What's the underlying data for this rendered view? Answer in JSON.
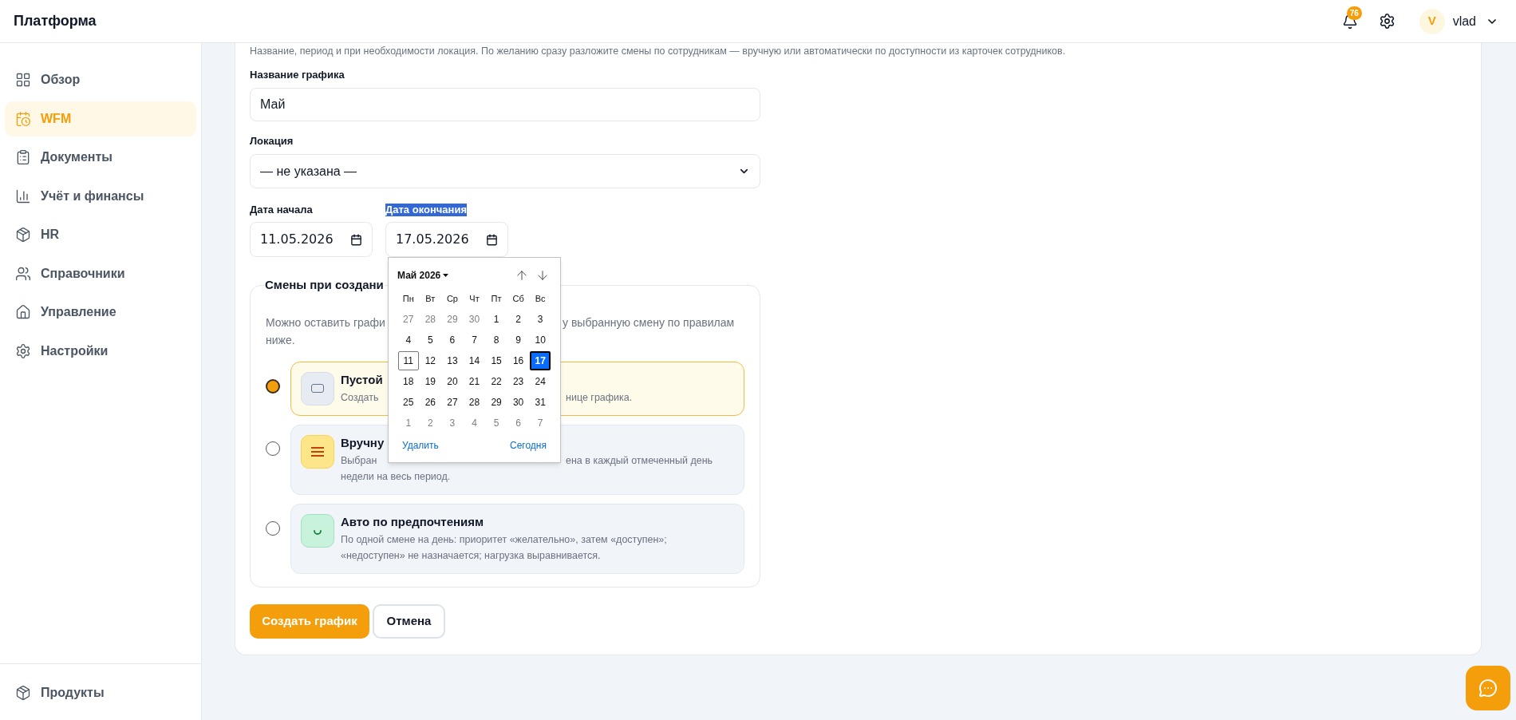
{
  "app": {
    "title": "Платформа"
  },
  "header": {
    "notifications": "76",
    "user": {
      "initial": "V",
      "name": "vlad"
    }
  },
  "sidebar": {
    "items": [
      {
        "label": "Обзор",
        "selected": false
      },
      {
        "label": "WFM",
        "selected": true
      },
      {
        "label": "Документы",
        "selected": false
      },
      {
        "label": "Учёт и финансы",
        "selected": false
      },
      {
        "label": "HR",
        "selected": false
      },
      {
        "label": "Справочники",
        "selected": false
      },
      {
        "label": "Управление",
        "selected": false
      },
      {
        "label": "Настройки",
        "selected": false
      }
    ],
    "footer": [
      {
        "label": "Продукты",
        "selected": false
      }
    ]
  },
  "form": {
    "intro": "Название, период и при необходимости локация. По желанию сразу разложите смены по сотрудникам — вручную или автоматически по доступности из карточек сотрудников.",
    "name_field": {
      "label": "Название графика",
      "value": "Май"
    },
    "location": {
      "label": "Локация",
      "value": "— не указана —"
    },
    "start_date": {
      "label": "Дата начала",
      "value": "11.05.2026",
      "highlighted": false
    },
    "end_date": {
      "label": "Дата окончания",
      "value": "17.05.2026",
      "highlighted": true
    }
  },
  "date_picker": {
    "month": "Май 2026",
    "weekdays": [
      "Пн",
      "Вт",
      "Ср",
      "Чт",
      "Пт",
      "Сб",
      "Вс"
    ],
    "days": [
      {
        "label": "27",
        "outside": true,
        "today": false,
        "selected": false
      },
      {
        "label": "28",
        "outside": true,
        "today": false,
        "selected": false
      },
      {
        "label": "29",
        "outside": true,
        "today": false,
        "selected": false
      },
      {
        "label": "30",
        "outside": true,
        "today": false,
        "selected": false
      },
      {
        "label": "1",
        "outside": false,
        "today": false,
        "selected": false
      },
      {
        "label": "2",
        "outside": false,
        "today": false,
        "selected": false
      },
      {
        "label": "3",
        "outside": false,
        "today": false,
        "selected": false
      },
      {
        "label": "4",
        "outside": false,
        "today": false,
        "selected": false
      },
      {
        "label": "5",
        "outside": false,
        "today": false,
        "selected": false
      },
      {
        "label": "6",
        "outside": false,
        "today": false,
        "selected": false
      },
      {
        "label": "7",
        "outside": false,
        "today": false,
        "selected": false
      },
      {
        "label": "8",
        "outside": false,
        "today": false,
        "selected": false
      },
      {
        "label": "9",
        "outside": false,
        "today": false,
        "selected": false
      },
      {
        "label": "10",
        "outside": false,
        "today": false,
        "selected": false
      },
      {
        "label": "11",
        "outside": false,
        "today": true,
        "selected": false
      },
      {
        "label": "12",
        "outside": false,
        "today": false,
        "selected": false
      },
      {
        "label": "13",
        "outside": false,
        "today": false,
        "selected": false
      },
      {
        "label": "14",
        "outside": false,
        "today": false,
        "selected": false
      },
      {
        "label": "15",
        "outside": false,
        "today": false,
        "selected": false
      },
      {
        "label": "16",
        "outside": false,
        "today": false,
        "selected": false
      },
      {
        "label": "17",
        "outside": false,
        "today": false,
        "selected": true
      },
      {
        "label": "18",
        "outside": false,
        "today": false,
        "selected": false
      },
      {
        "label": "19",
        "outside": false,
        "today": false,
        "selected": false
      },
      {
        "label": "20",
        "outside": false,
        "today": false,
        "selected": false
      },
      {
        "label": "21",
        "outside": false,
        "today": false,
        "selected": false
      },
      {
        "label": "22",
        "outside": false,
        "today": false,
        "selected": false
      },
      {
        "label": "23",
        "outside": false,
        "today": false,
        "selected": false
      },
      {
        "label": "24",
        "outside": false,
        "today": false,
        "selected": false
      },
      {
        "label": "25",
        "outside": false,
        "today": false,
        "selected": false
      },
      {
        "label": "26",
        "outside": false,
        "today": false,
        "selected": false
      },
      {
        "label": "27",
        "outside": false,
        "today": false,
        "selected": false
      },
      {
        "label": "28",
        "outside": false,
        "today": false,
        "selected": false
      },
      {
        "label": "29",
        "outside": false,
        "today": false,
        "selected": false
      },
      {
        "label": "30",
        "outside": false,
        "today": false,
        "selected": false
      },
      {
        "label": "31",
        "outside": false,
        "today": false,
        "selected": false
      },
      {
        "label": "1",
        "outside": true,
        "today": false,
        "selected": false
      },
      {
        "label": "2",
        "outside": true,
        "today": false,
        "selected": false
      },
      {
        "label": "3",
        "outside": true,
        "today": false,
        "selected": false
      },
      {
        "label": "4",
        "outside": true,
        "today": false,
        "selected": false
      },
      {
        "label": "5",
        "outside": true,
        "today": false,
        "selected": false
      },
      {
        "label": "6",
        "outside": true,
        "today": false,
        "selected": false
      },
      {
        "label": "7",
        "outside": true,
        "today": false,
        "selected": false
      }
    ],
    "clear": "Удалить",
    "today": "Сегодня"
  },
  "shifts_section": {
    "title": "Смены при создани",
    "description_parts": [
      "Можно оставить графи",
      "у выбранную смену по правилам"
    ],
    "description_end": "ниже.",
    "options": [
      {
        "selected": true,
        "title": "Пустой",
        "description_parts": [
          "Создать",
          "нице графика."
        ]
      },
      {
        "selected": false,
        "title": "Вручну",
        "description_parts": [
          "Выбран",
          "ена в каждый отмеченный день"
        ],
        "description_more": "недели на весь период."
      },
      {
        "selected": false,
        "title": "Авто по предпочтениям",
        "description": "По одной смене на день: приоритет «желательно», затем «доступен»; «недоступен» не назначается; нагрузка выравнивается."
      }
    ]
  },
  "buttons": [
    {
      "label": "Создать график",
      "kind": "primary"
    },
    {
      "label": "Отмена",
      "kind": "secondary"
    }
  ]
}
